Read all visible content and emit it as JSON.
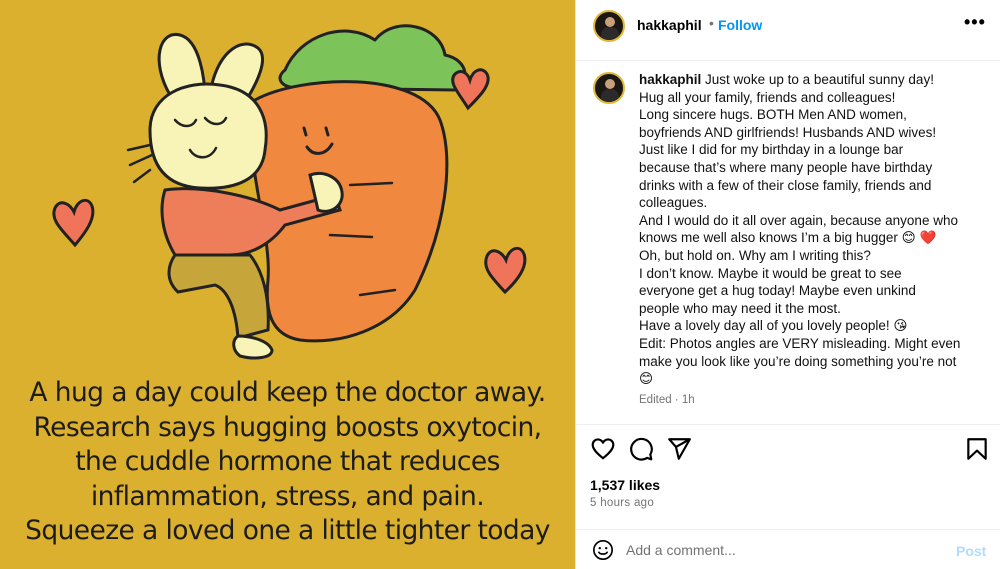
{
  "colors": {
    "background_yellow": "#dcb02f",
    "carrot_orange": "#f0883f",
    "heart": "#ef7459",
    "bunny": "#f8f3b6",
    "shirt": "#ee7d59",
    "pants": "#c6a53a",
    "follow_blue": "#0095f6",
    "post_disabled": "#b3dbff"
  },
  "image": {
    "caption_lines": [
      "A hug a day could keep the doctor away.",
      "Research says hugging boosts oxytocin,",
      "the cuddle hormone that reduces",
      "inflammation, stress, and pain.",
      "Squeeze a loved one a little tighter today"
    ]
  },
  "header": {
    "username": "hakkaphil",
    "separator": "•",
    "follow_label": "Follow",
    "more_label": "•••"
  },
  "post": {
    "username": "hakkaphil",
    "first_line": "Just woke up to a beautiful sunny day!",
    "lines": [
      "Hug all your family, friends and colleagues!",
      "Long sincere hugs. BOTH Men AND women,",
      "boyfriends AND girlfriends! Husbands AND wives!",
      "Just like I did for my birthday in a lounge bar",
      "because that’s where many people have birthday",
      "drinks with a few of their close family, friends and",
      "colleagues.",
      "And I would do it all over again, because anyone who",
      "knows me well also knows I’m a big hugger 😊 ❤️",
      "Oh, but hold on. Why am I writing this?",
      "I don’t know. Maybe it would be great to see",
      "everyone get a hug today! Maybe even unkind",
      "people who may need it the most.",
      "Have a lovely day all of you lovely people! 😘",
      "Edit: Photos angles are VERY misleading. Might even",
      "make you look like you’re doing something you’re not",
      "😊"
    ],
    "edited_label": "Edited · 1h"
  },
  "actions": {
    "icons": [
      "heart-icon",
      "comment-icon",
      "share-icon",
      "bookmark-icon"
    ]
  },
  "stats": {
    "likes": "1,537 likes",
    "time_ago": "5 hours ago"
  },
  "comment": {
    "placeholder": "Add a comment...",
    "post_label": "Post"
  }
}
